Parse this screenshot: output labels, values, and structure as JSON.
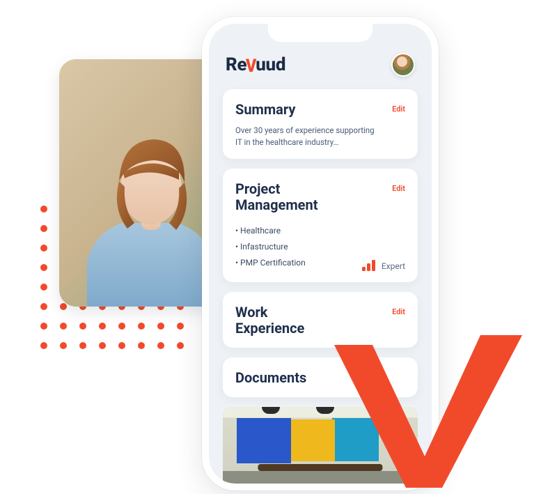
{
  "brand": {
    "name_pre": "Re",
    "name_accent": "V",
    "name_post": "uud"
  },
  "cards": {
    "summary": {
      "title": "Summary",
      "edit": "Edit",
      "text": "Over 30 years of experience supporting IT in the healthcare industry…"
    },
    "project_management": {
      "title": "Project\nManagement",
      "edit": "Edit",
      "bullets": [
        "Healthcare",
        "Infastructure",
        "PMP Certification"
      ],
      "level_label": "Expert"
    },
    "work_experience": {
      "title": "Work\nExperience",
      "edit": "Edit"
    },
    "documents": {
      "title": "Documents"
    }
  }
}
